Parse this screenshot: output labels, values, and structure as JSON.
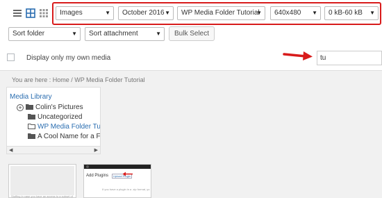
{
  "view_icons": [
    "list-view-icon",
    "grid-view-icon",
    "tiles-view-icon"
  ],
  "filters": {
    "type": "Images",
    "date": "October 2016",
    "folder": "WP Media Folder Tutorial",
    "dimension": "640x480",
    "size": "0 kB-60 kB"
  },
  "sort": {
    "folder": "Sort folder",
    "attachment": "Sort attachment",
    "bulk_label": "Bulk Select"
  },
  "own_media_label": "Display only my own media",
  "search": {
    "value": "tu"
  },
  "breadcrumb": "You are here :  Home  /  WP Media Folder Tutorial",
  "tree": {
    "root": "Media Library",
    "items": [
      {
        "label": "Colin's Pictures",
        "expandable": true
      },
      {
        "label": "Uncategorized"
      },
      {
        "label": "WP Media Folder Tutoria",
        "active": true
      },
      {
        "label": "A Cool Name for a Folde"
      }
    ]
  },
  "thumbnails": {
    "thumb1_caption": "Stuffing in case you have an access to a subset of",
    "thumb2_heading": "Add Plugins",
    "thumb2_button": "Upload Plugin",
    "thumb2_text": "If you have a plugin in a .zip format, yo"
  },
  "colors": {
    "highlight_border": "#d81b1b",
    "link": "#2a6db0",
    "arrow": "#d81b1b"
  }
}
